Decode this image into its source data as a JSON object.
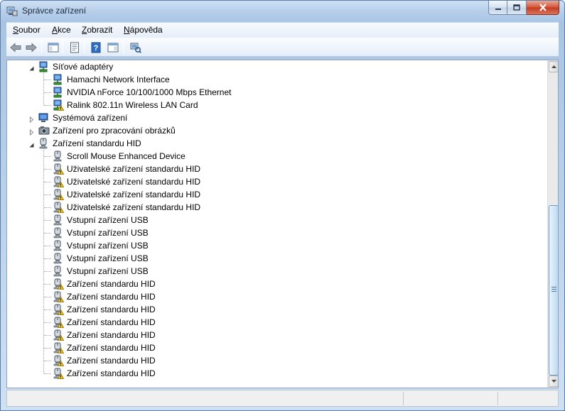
{
  "window": {
    "title": "Správce zařízení"
  },
  "menu": [
    {
      "label": "Soubor",
      "accel": "S",
      "rest": "oubor"
    },
    {
      "label": "Akce",
      "accel": "A",
      "rest": "kce"
    },
    {
      "label": "Zobrazit",
      "accel": "Z",
      "rest": "obrazit"
    },
    {
      "label": "Nápověda",
      "accel": "N",
      "rest": "ápověda"
    }
  ],
  "toolbar": [
    {
      "name": "back-arrow-icon"
    },
    {
      "name": "forward-arrow-icon"
    },
    {
      "name": "show-hide-console-tree-icon"
    },
    {
      "name": "properties-icon"
    },
    {
      "name": "help-icon"
    },
    {
      "name": "action-pane-icon"
    },
    {
      "name": "scan-hardware-changes-icon"
    }
  ],
  "tree": [
    {
      "level": 0,
      "label": "Síťové adaptéry",
      "icon": "network-adapter-icon",
      "expander": "expanded"
    },
    {
      "level": 1,
      "label": "Hamachi Network Interface",
      "icon": "network-adapter-icon"
    },
    {
      "level": 1,
      "label": "NVIDIA nForce 10/100/1000 Mbps Ethernet",
      "icon": "network-adapter-icon"
    },
    {
      "level": 1,
      "label": "Ralink 802.11n Wireless LAN Card",
      "icon": "network-adapter-warning-icon"
    },
    {
      "level": 0,
      "label": "Systémová zařízení",
      "icon": "system-devices-icon",
      "expander": "collapsed"
    },
    {
      "level": 0,
      "label": "Zařízení pro zpracování obrázků",
      "icon": "imaging-device-icon",
      "expander": "collapsed"
    },
    {
      "level": 0,
      "label": "Zařízení standardu HID",
      "icon": "hid-device-icon",
      "expander": "expanded"
    },
    {
      "level": 1,
      "label": "Scroll Mouse Enhanced Device",
      "icon": "hid-device-icon"
    },
    {
      "level": 1,
      "label": "Uživatelské zařízení standardu HID",
      "icon": "hid-device-warning-icon"
    },
    {
      "level": 1,
      "label": "Uživatelské zařízení standardu HID",
      "icon": "hid-device-warning-icon"
    },
    {
      "level": 1,
      "label": "Uživatelské zařízení standardu HID",
      "icon": "hid-device-warning-icon"
    },
    {
      "level": 1,
      "label": "Uživatelské zařízení standardu HID",
      "icon": "hid-device-warning-icon"
    },
    {
      "level": 1,
      "label": "Vstupní zařízení USB",
      "icon": "hid-device-icon"
    },
    {
      "level": 1,
      "label": "Vstupní zařízení USB",
      "icon": "hid-device-icon"
    },
    {
      "level": 1,
      "label": "Vstupní zařízení USB",
      "icon": "hid-device-icon"
    },
    {
      "level": 1,
      "label": "Vstupní zařízení USB",
      "icon": "hid-device-icon"
    },
    {
      "level": 1,
      "label": "Vstupní zařízení USB",
      "icon": "hid-device-icon"
    },
    {
      "level": 1,
      "label": "Zařízení standardu HID",
      "icon": "hid-device-warning-icon"
    },
    {
      "level": 1,
      "label": "Zařízení standardu HID",
      "icon": "hid-device-warning-icon"
    },
    {
      "level": 1,
      "label": "Zařízení standardu HID",
      "icon": "hid-device-warning-icon"
    },
    {
      "level": 1,
      "label": "Zařízení standardu HID",
      "icon": "hid-device-warning-icon"
    },
    {
      "level": 1,
      "label": "Zařízení standardu HID",
      "icon": "hid-device-warning-icon"
    },
    {
      "level": 1,
      "label": "Zařízení standardu HID",
      "icon": "hid-device-warning-icon"
    },
    {
      "level": 1,
      "label": "Zařízení standardu HID",
      "icon": "hid-device-warning-icon"
    },
    {
      "level": 1,
      "label": "Zařízení standardu HID",
      "icon": "hid-device-warning-icon"
    }
  ],
  "colors": {
    "titlebar": "#b7cfea",
    "warning": "#f5d21a",
    "close_button": "#c33a1e"
  }
}
